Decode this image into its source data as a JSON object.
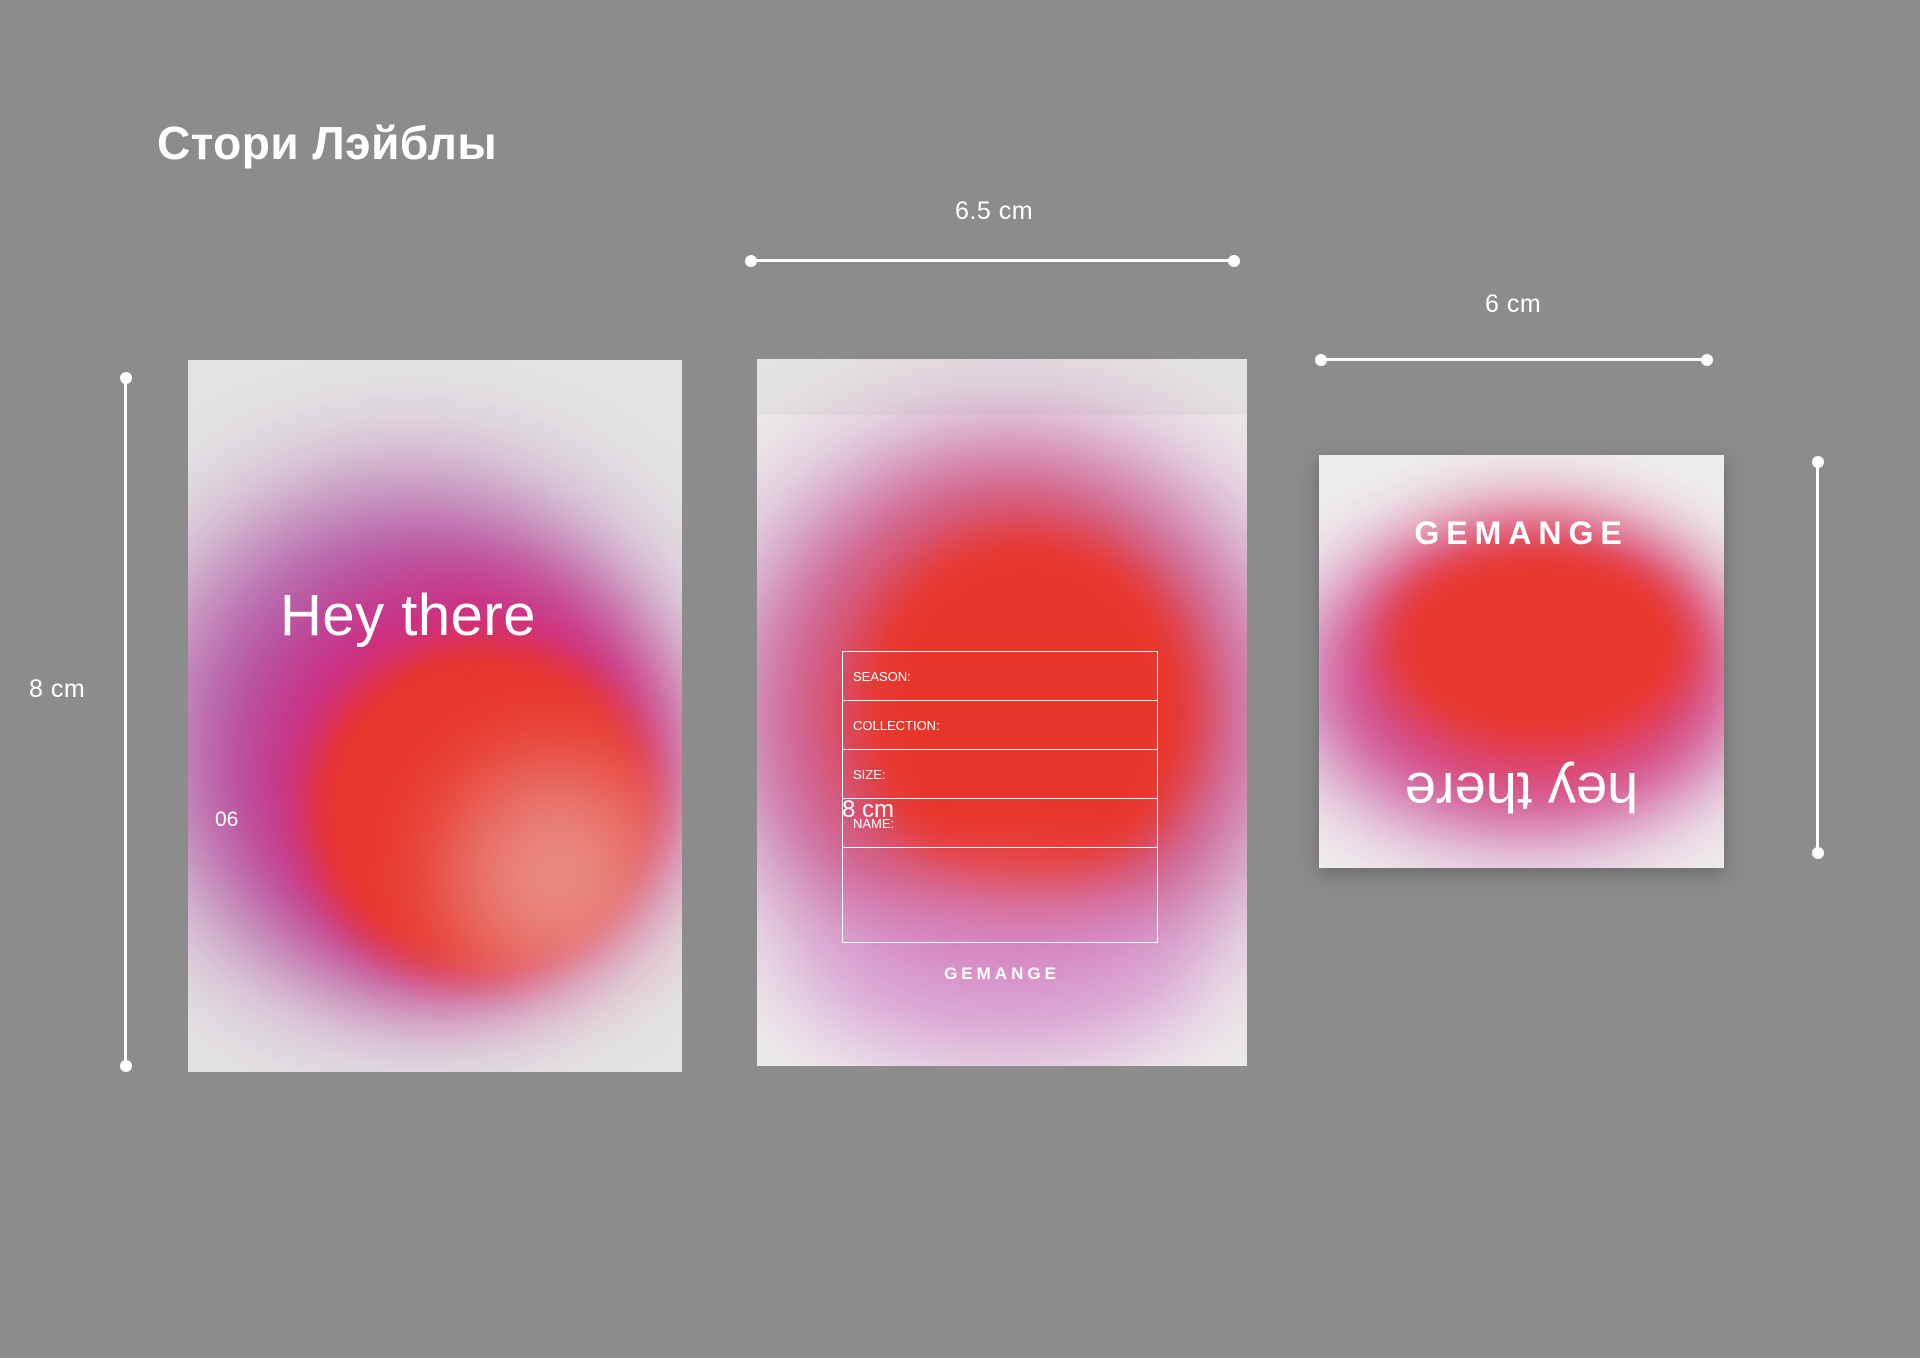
{
  "title": "Стори Лэйблы",
  "dimensions": {
    "top_width": "6.5  cm",
    "square_width": "6 cm",
    "left_height": "8 cm"
  },
  "card_story": {
    "heading": "Hey there",
    "number": "06"
  },
  "card_form": {
    "fields": [
      "SEASON:",
      "COLLECTION:",
      "SIZE:",
      "NAME:"
    ],
    "overlay_dimension": "8 cm",
    "brand": "GEMANGE"
  },
  "card_square": {
    "brand": "GEMANGE",
    "tagline": "hey there"
  },
  "colors": {
    "background": "#8d8c8c",
    "accent_red": "#e8352a",
    "accent_magenta": "#d62478"
  }
}
